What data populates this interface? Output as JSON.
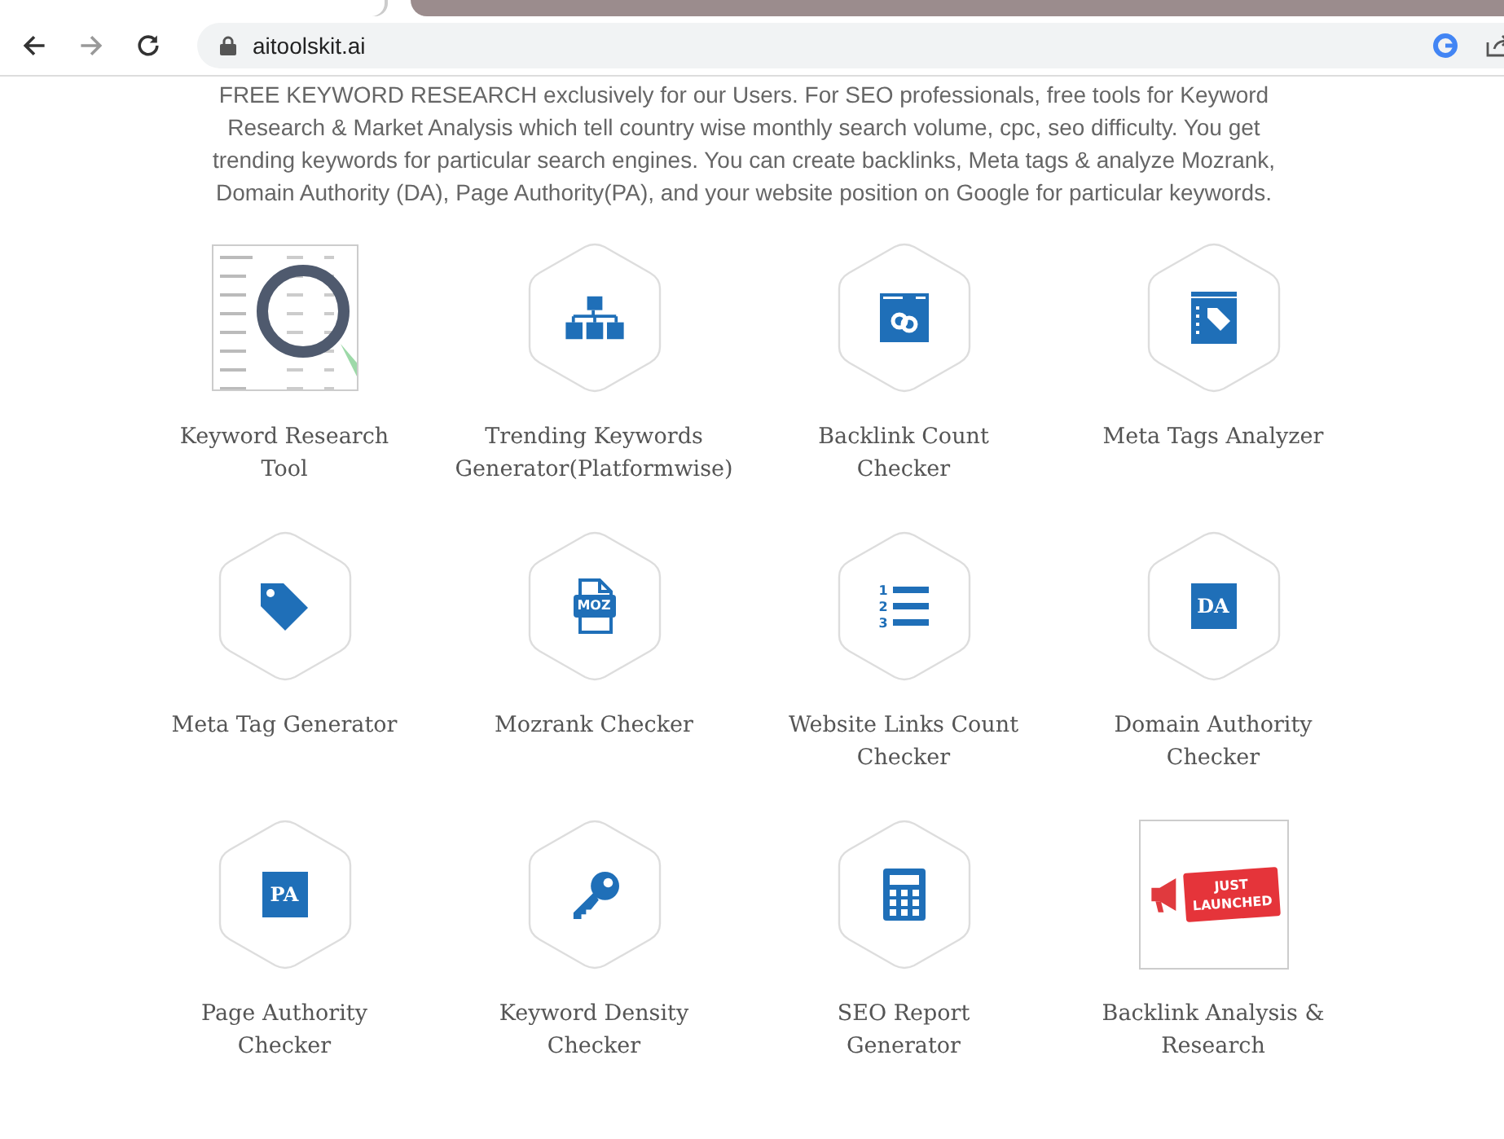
{
  "browser": {
    "url": "aitoolskit.ai"
  },
  "intro": "FREE KEYWORD RESEARCH exclusively for our Users. For SEO professionals, free tools for Keyword Research & Market Analysis which tell country wise monthly search volume, cpc, seo difficulty. You get trending keywords for particular search engines. You can create backlinks, Meta tags & analyze Mozrank, Domain Authority (DA), Page Authority(PA), and your website position on Google for particular keywords.",
  "tools": [
    {
      "kind": "table",
      "label": "Keyword Research Tool"
    },
    {
      "kind": "sitemap",
      "label": "Trending Keywords Generator(Platformwise)"
    },
    {
      "kind": "link",
      "label": "Backlink Count Checker"
    },
    {
      "kind": "tagpage",
      "label": "Meta Tags Analyzer"
    },
    {
      "kind": "tag",
      "label": "Meta Tag Generator"
    },
    {
      "kind": "file",
      "icon_text": "MOZ",
      "label": "Mozrank Checker"
    },
    {
      "kind": "list",
      "icon_numbers": [
        "1",
        "2",
        "3"
      ],
      "label": "Website Links Count Checker"
    },
    {
      "kind": "letter",
      "icon_text": "DA",
      "label": "Domain Authority Checker"
    },
    {
      "kind": "letter",
      "icon_text": "PA",
      "label": "Page Authority Checker"
    },
    {
      "kind": "key",
      "label": "Keyword Density Checker"
    },
    {
      "kind": "calculator",
      "label": "SEO Report Generator"
    },
    {
      "kind": "banner",
      "icon_text": "JUST LAUNCHED",
      "label": "Backlink Analysis & Research"
    }
  ]
}
